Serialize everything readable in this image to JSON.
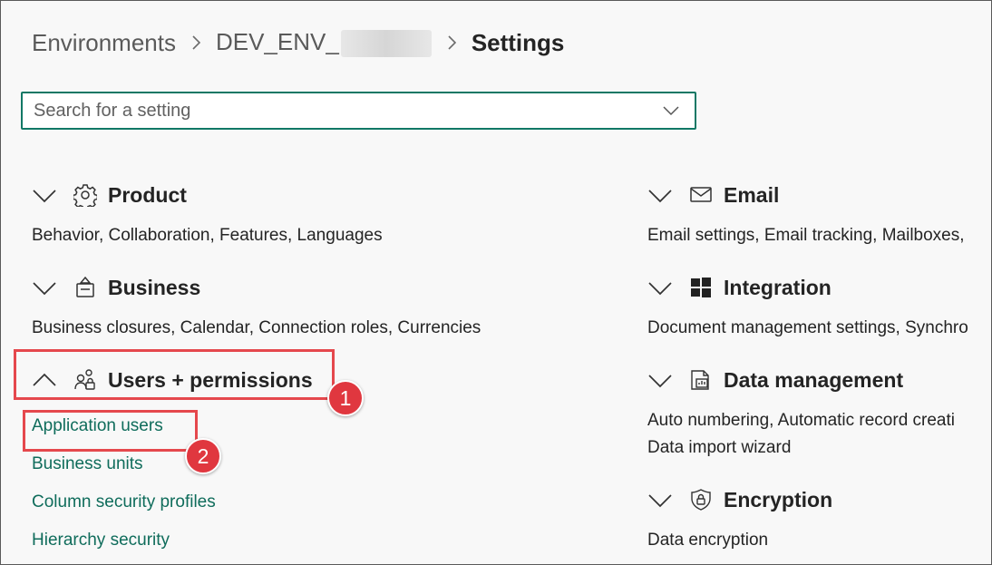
{
  "breadcrumb": {
    "items": [
      "Environments",
      "DEV_ENV_",
      "Settings"
    ]
  },
  "search": {
    "placeholder": "Search for a setting"
  },
  "sections": {
    "product": {
      "title": "Product",
      "description": "Behavior, Collaboration, Features, Languages",
      "icon": "gear-icon",
      "expanded": false
    },
    "business": {
      "title": "Business",
      "description": "Business closures, Calendar, Connection roles, Currencies",
      "icon": "business-icon",
      "expanded": false
    },
    "users": {
      "title": "Users + permissions",
      "icon": "people-lock-icon",
      "expanded": true,
      "links": [
        "Application users",
        "Business units",
        "Column security profiles",
        "Hierarchy security"
      ]
    },
    "email": {
      "title": "Email",
      "description": "Email settings, Email tracking, Mailboxes,",
      "icon": "mail-icon",
      "expanded": false
    },
    "integration": {
      "title": "Integration",
      "description": "Document management settings, Synchro",
      "icon": "windows-icon",
      "expanded": false
    },
    "data_management": {
      "title": "Data management",
      "description_lines": [
        "Auto numbering, Automatic record creati",
        "Data import wizard"
      ],
      "icon": "data-management-icon",
      "expanded": false
    },
    "encryption": {
      "title": "Encryption",
      "description": "Data encryption",
      "icon": "shield-lock-icon",
      "expanded": false
    }
  },
  "callouts": [
    "1",
    "2"
  ],
  "colors": {
    "accent": "#117865",
    "link": "#0f6c5b",
    "callout": "#e0373f"
  }
}
